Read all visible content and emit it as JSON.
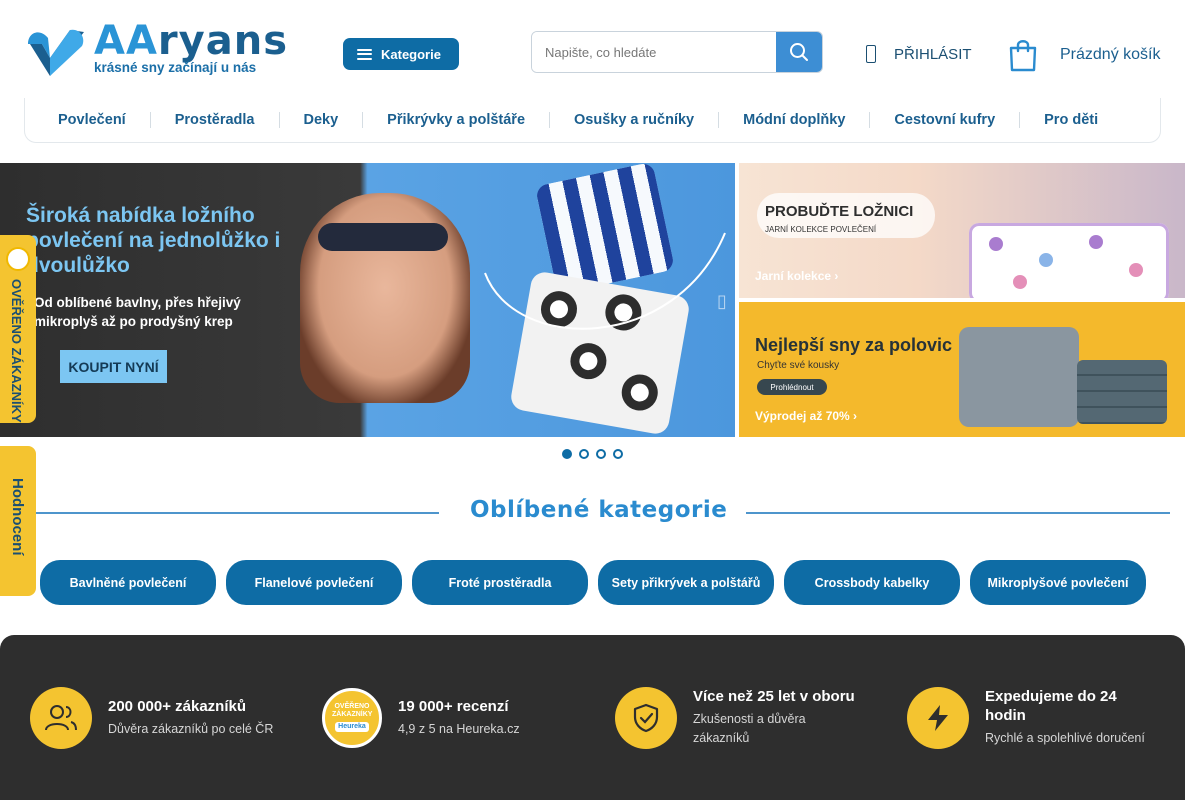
{
  "header": {
    "logo_word_aa": "AA",
    "logo_word_rest": "ryans",
    "logo_tagline": "krásné sny začínají u nás",
    "categories_button": "Kategorie",
    "search_placeholder": "Napište, co hledáte",
    "login_label": "PŘIHLÁSIT",
    "cart_label": "Prázdný košík"
  },
  "nav": {
    "items": [
      "Povlečení",
      "Prostěradla",
      "Deky",
      "Přikrývky a polštáře",
      "Osušky a ručníky",
      "Módní doplňky",
      "Cestovní kufry",
      "Pro děti"
    ]
  },
  "banner_main": {
    "title": "Široká nabídka ložního povlečení na jednolůžko i dvoulůžko",
    "text": "Od oblíbené bavlny, přes hřejivý mikroplyš až po prodyšný krep",
    "button": "KOUPIT NYNÍ"
  },
  "banner_right_top": {
    "title": "PROBUĎTE LOŽNICI",
    "subtitle": "JARNÍ KOLEKCE POVLEČENÍ",
    "link": "Jarní kolekce ›"
  },
  "banner_right_bottom": {
    "title": "Nejlepší sny za polovic",
    "subtitle": "Chyťte své kousky",
    "button": "Prohlédnout",
    "link": "Výprodej až 70% ›"
  },
  "side_tabs": {
    "verified": "OVĚŘENO ZÁKAZNÍKY",
    "rating": "Hodnocení"
  },
  "slider": {
    "slides": 4,
    "active": 1
  },
  "popular": {
    "title": "Oblíbené kategorie",
    "items": [
      "Bavlněné povlečení",
      "Flanelové povlečení",
      "Froté prostěradla",
      "Sety přikrývek a polštářů",
      "Crossbody kabelky",
      "Mikroplyšové povlečení"
    ]
  },
  "features": [
    {
      "icon": "users-icon",
      "title": "200 000+ zákazníků",
      "subtitle": "Důvěra zákazníků po celé ČR"
    },
    {
      "icon": "heureka-seal-icon",
      "title": "19 000+ recenzí",
      "subtitle": "4,9 z 5 na Heureka.cz",
      "seal_text": "OVĚŘENO ZÁKAZNÍKY",
      "seal_brand": "Heureka"
    },
    {
      "icon": "shield-check-icon",
      "title": "Více než 25 let v oboru",
      "subtitle": "Zkušenosti a důvěra zákazníků"
    },
    {
      "icon": "lightning-icon",
      "title": "Expedujeme do 24 hodin",
      "subtitle": "Rychlé a spolehlivé doručení"
    }
  ],
  "colors": {
    "brand_blue": "#0e6ca5",
    "accent_yellow": "#f4c430",
    "footer_dark": "#2e2e2e"
  }
}
